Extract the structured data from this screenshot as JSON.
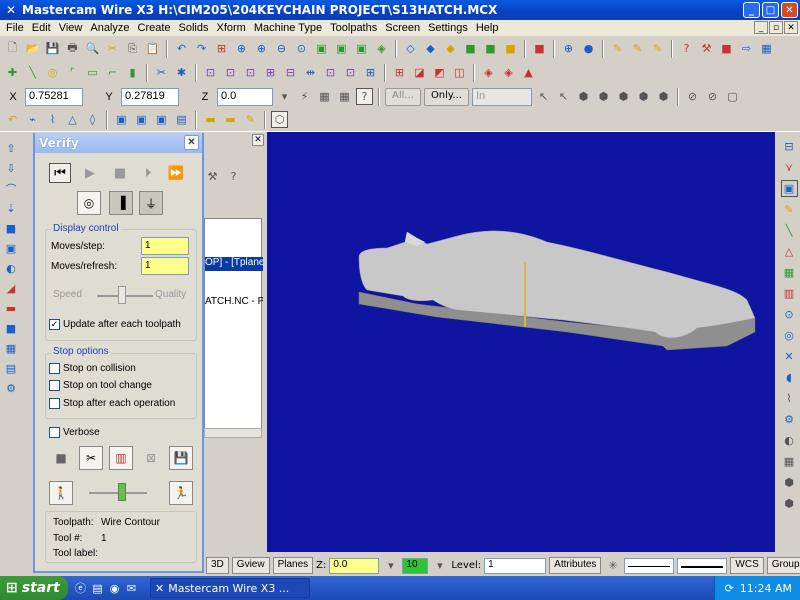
{
  "window": {
    "title": "Mastercam Wire X3  H:\\CIM205\\204KEYCHAIN PROJECT\\S13HATCH.MCX"
  },
  "menu": [
    "File",
    "Edit",
    "View",
    "Analyze",
    "Create",
    "Solids",
    "Xform",
    "Machine Type",
    "Toolpaths",
    "Screen",
    "Settings",
    "Help"
  ],
  "coords": {
    "x_label": "X",
    "x_value": "0.75281",
    "y_label": "Y",
    "y_value": "0.27819",
    "z_label": "Z",
    "z_value": "0.0",
    "all_label": "All...",
    "only_label": "Only...",
    "in_label": "In"
  },
  "manager": {
    "selected_text": "OP] - [Tplane:",
    "nc_text": "ATCH.NC - Prog"
  },
  "verify": {
    "title": "Verify",
    "display_control_label": "Display control",
    "moves_step_label": "Moves/step:",
    "moves_step_value": "1",
    "moves_refresh_label": "Moves/refresh:",
    "moves_refresh_value": "1",
    "speed_label": "Speed",
    "quality_label": "Quality",
    "update_label": "Update after each toolpath",
    "stop_options_label": "Stop options",
    "stop_collision": "Stop on collision",
    "stop_tool_change": "Stop on tool change",
    "stop_each_op": "Stop after each operation",
    "verbose": "Verbose",
    "toolpath_label": "Toolpath:",
    "toolpath_value": "Wire Contour",
    "tool_num_label": "Tool #:",
    "tool_num_value": "1",
    "tool_label_label": "Tool label:",
    "speed_level": 0.4,
    "quality_level": 0.45
  },
  "statusbar": {
    "b3d": "3D",
    "gview": "Gview",
    "planes": "Planes",
    "z_label": "Z:",
    "z_value": "0.0",
    "color_value": "10",
    "level_label": "Level:",
    "level_value": "1",
    "attributes": "Attributes",
    "wcs": "WCS",
    "groups": "Groups"
  },
  "taskbar": {
    "start": "start",
    "task": "Mastercam Wire X3 ...",
    "time": "11:24 AM"
  },
  "colors": {
    "viewport": "#0f15a0",
    "part": "#c8c8c8",
    "tool": "#d9b24a"
  }
}
